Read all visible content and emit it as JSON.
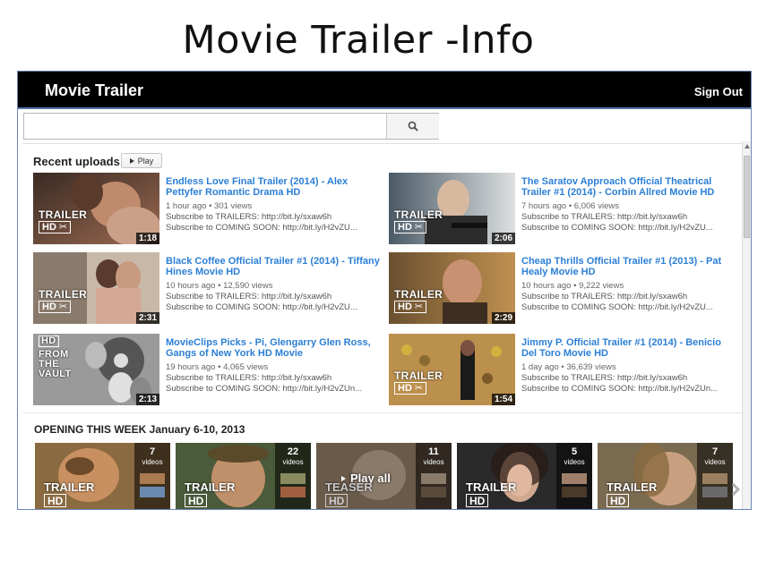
{
  "slide_title": "Movie Trailer  -Info",
  "header": {
    "brand": "Movie Trailer",
    "sign_out": "Sign Out"
  },
  "search": {
    "value": "",
    "placeholder": ""
  },
  "recent": {
    "heading": "Recent uploads",
    "play_label": "Play",
    "badge_trailer": "TRAILER",
    "badge_hd": "HD",
    "videos": [
      {
        "title": "Endless Love Final Trailer (2014) - Alex Pettyfer Romantic Drama HD",
        "age": "1 hour ago",
        "views": "301 views",
        "desc1": "Subscribe to TRAILERS: http://bit.ly/sxaw6h",
        "desc2": "Subscribe to COMING SOON: http://bit.ly/H2vZU...",
        "duration": "1:18"
      },
      {
        "title": "The Saratov Approach Official Theatrical Trailer #1 (2014) - Corbin Allred Movie HD",
        "age": "7 hours ago",
        "views": "6,006 views",
        "desc1": "Subscribe to TRAILERS: http://bit.ly/sxaw6h",
        "desc2": "Subscribe to COMING SOON: http://bit.ly/H2vZU...",
        "duration": "2:06"
      },
      {
        "title": "Black Coffee Official Trailer #1 (2014) - Tiffany Hines Movie HD",
        "age": "10 hours ago",
        "views": "12,590 views",
        "desc1": "Subscribe to TRAILERS: http://bit.ly/sxaw6h",
        "desc2": "Subscribe to COMING SOON: http://bit.ly/H2vZU...",
        "duration": "2:31"
      },
      {
        "title": "Cheap Thrills Official Trailer #1 (2013) - Pat Healy Movie HD",
        "age": "10 hours ago",
        "views": "9,222 views",
        "desc1": "Subscribe to TRAILERS: http://bit.ly/sxaw6h",
        "desc2": "Subscribe to COMING SOON: http://bit.ly/H2vZU...",
        "duration": "2:29"
      },
      {
        "title": "MovieClips Picks - Pi, Glengarry Glen Ross, Gangs of New York HD Movie",
        "age": "19 hours ago",
        "views": "4,065 views",
        "desc1": "Subscribe to TRAILERS: http://bit.ly/sxaw6h",
        "desc2": "Subscribe to COMING SOON: http://bit.ly/H2vZUn...",
        "duration": "2:13",
        "badge_lines": [
          "HD",
          "FROM",
          "THE",
          "VAULT"
        ]
      },
      {
        "title": "Jimmy P. Official Trailer #1 (2014) - Benicio Del Toro Movie HD",
        "age": "1 day ago",
        "views": "36,639 views",
        "desc1": "Subscribe to TRAILERS: http://bit.ly/sxaw6h",
        "desc2": "Subscribe to COMING SOON: http://bit.ly/H2vZUn...",
        "duration": "1:54"
      }
    ]
  },
  "opening": {
    "heading": "OPENING THIS WEEK January 6-10, 2013",
    "videos_label": "videos",
    "play_all": "Play all",
    "teaser": "TEASER",
    "playlists": [
      {
        "count": "7"
      },
      {
        "count": "22"
      },
      {
        "count": "11"
      },
      {
        "count": "5"
      },
      {
        "count": "7"
      }
    ]
  }
}
